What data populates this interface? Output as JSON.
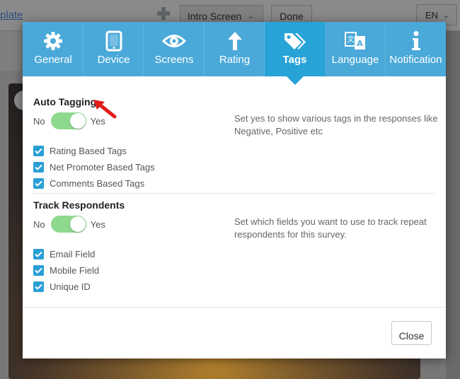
{
  "background": {
    "template_link": "plate",
    "screen_select": "Intro Screen",
    "done_button": "Done",
    "language_select": "EN"
  },
  "tabs": [
    {
      "label": "General",
      "icon": "gear-icon"
    },
    {
      "label": "Device",
      "icon": "tablet-icon"
    },
    {
      "label": "Screens",
      "icon": "eye-icon"
    },
    {
      "label": "Rating",
      "icon": "arrow-up-icon"
    },
    {
      "label": "Tags",
      "icon": "tags-icon",
      "active": true
    },
    {
      "label": "Language",
      "icon": "translate-icon"
    },
    {
      "label": "Notification",
      "icon": "info-icon"
    }
  ],
  "auto_tagging": {
    "title": "Auto Tagging",
    "toggle_off": "No",
    "toggle_on": "Yes",
    "enabled": true,
    "help": "Set yes to show various tags in the responses like Negative, Positive etc",
    "options": [
      {
        "label": "Rating Based Tags",
        "checked": true
      },
      {
        "label": "Net Promoter Based Tags",
        "checked": true
      },
      {
        "label": "Comments Based Tags",
        "checked": true
      }
    ]
  },
  "track_respondents": {
    "title": "Track Respondents",
    "toggle_off": "No",
    "toggle_on": "Yes",
    "enabled": true,
    "help": "Set which fields you want to use to track repeat respondents for this survey.",
    "options": [
      {
        "label": "Email Field",
        "checked": true
      },
      {
        "label": "Mobile Field",
        "checked": true
      },
      {
        "label": "Unique ID",
        "checked": true
      }
    ]
  },
  "footer": {
    "close_label": "Close"
  },
  "colors": {
    "tab_bar": "#4aa9d9",
    "tab_active": "#27a3d7",
    "toggle_on": "#8fd98f",
    "checkbox": "#2a9fd6",
    "annotation_arrow": "#e21b1b"
  }
}
